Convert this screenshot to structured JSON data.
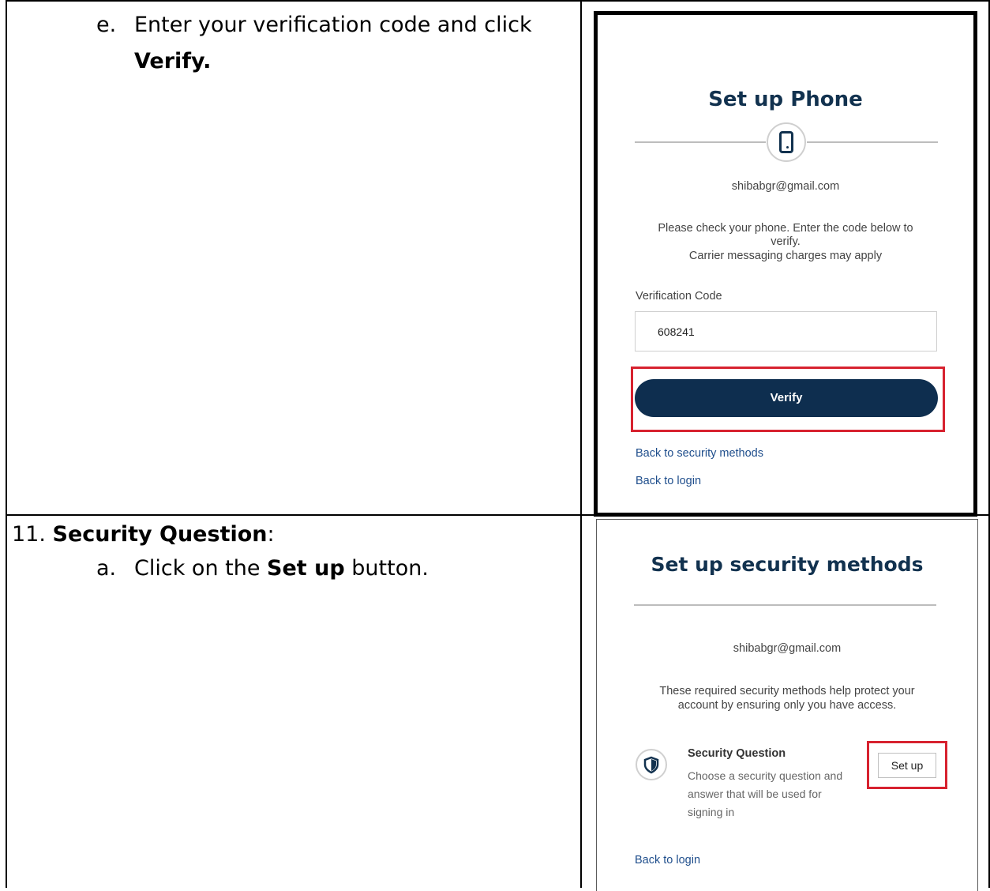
{
  "step_e": {
    "marker": "e.",
    "text": "Enter your verification code and click",
    "bold": "Verify."
  },
  "step_11": {
    "number": "11.",
    "title": "Security Question",
    "suffix": ":",
    "sub_marker": "a.",
    "sub_prefix": "Click on the",
    "sub_bold": "Set up",
    "sub_suffix": "button."
  },
  "phone_panel": {
    "title": "Set up Phone",
    "icon": "mobile-phone-icon",
    "email": "shibabgr@gmail.com",
    "instructions_1": "Please check your phone.  Enter the code below to",
    "instructions_2": "verify.",
    "instructions_3": "Carrier messaging charges may apply",
    "code_label": "Verification Code",
    "code_value": "608241",
    "verify_label": "Verify",
    "back_security": "Back to security methods",
    "back_login": "Back to login",
    "highlight_color": "#d7222f",
    "button_color": "#0e2e4f"
  },
  "methods_panel": {
    "title": "Set up security methods",
    "email": "shibabgr@gmail.com",
    "description_1": "These required security methods help protect your",
    "description_2": "account by ensuring only you have access.",
    "method_icon": "shield-icon",
    "method_title": "Security Question",
    "method_desc_1": "Choose a security question and",
    "method_desc_2": "answer that will be used for",
    "method_desc_3": "signing in",
    "setup_label": "Set up",
    "back_login": "Back to login"
  }
}
